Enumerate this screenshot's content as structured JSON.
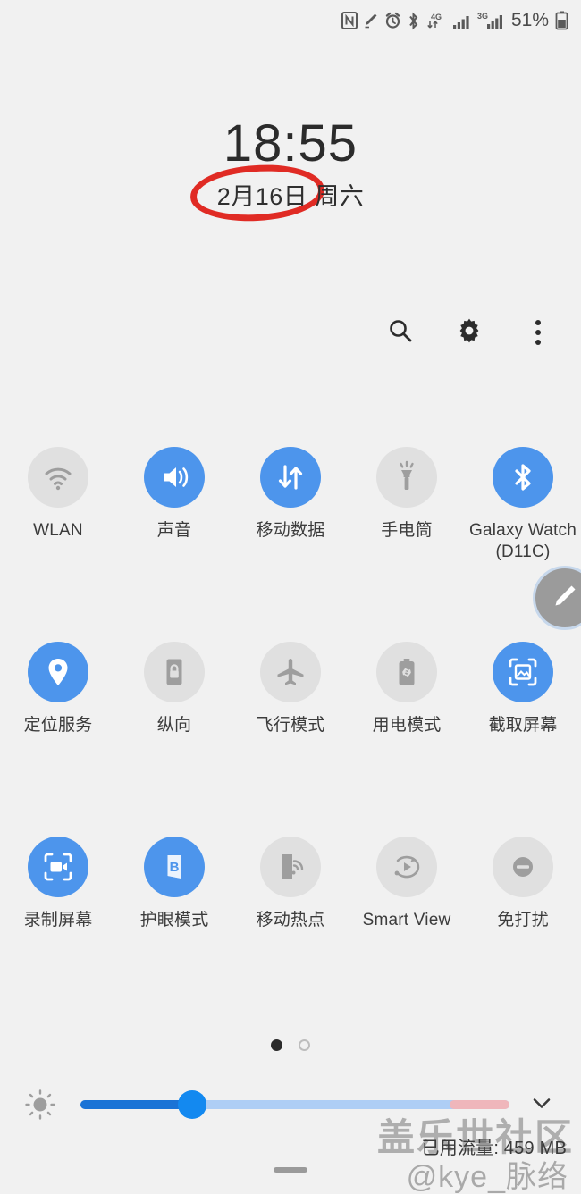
{
  "status_bar": {
    "battery_percent": "51%",
    "icons": [
      {
        "name": "nfc-icon"
      },
      {
        "name": "spen-icon"
      },
      {
        "name": "alarm-icon"
      },
      {
        "name": "bluetooth-icon"
      },
      {
        "name": "mobile-data-4g-icon",
        "label": "4G"
      },
      {
        "name": "signal-bars-sim1-icon"
      },
      {
        "name": "signal-bars-3g-sim2-icon",
        "label": "3G"
      },
      {
        "name": "battery-icon"
      }
    ]
  },
  "clock": {
    "time": "18:55",
    "date": "2月16日  周六",
    "annotation": {
      "name": "red-circle-annotation",
      "color": "#e02b24"
    }
  },
  "toolbar": {
    "search_label": "search-icon",
    "settings_label": "gear-icon",
    "more_label": "more-options-icon"
  },
  "quick_settings": {
    "rows": [
      [
        {
          "label": "WLAN",
          "icon": "wifi-icon",
          "state": "off"
        },
        {
          "label": "声音",
          "icon": "sound-icon",
          "state": "on"
        },
        {
          "label": "移动数据",
          "icon": "mobile-data-icon",
          "state": "on"
        },
        {
          "label": "手电筒",
          "icon": "flashlight-icon",
          "state": "off"
        },
        {
          "label": "Galaxy Watch\n(D11C)",
          "icon": "bluetooth-icon",
          "state": "on"
        }
      ],
      [
        {
          "label": "定位服务",
          "icon": "location-pin-icon",
          "state": "on"
        },
        {
          "label": "纵向",
          "icon": "rotation-lock-icon",
          "state": "off"
        },
        {
          "label": "飞行模式",
          "icon": "airplane-icon",
          "state": "off"
        },
        {
          "label": "用电模式",
          "icon": "power-mode-icon",
          "state": "off"
        },
        {
          "label": "截取屏幕",
          "icon": "screenshot-icon",
          "state": "on"
        }
      ],
      [
        {
          "label": "录制屏幕",
          "icon": "screen-record-icon",
          "state": "on"
        },
        {
          "label": "护眼模式",
          "icon": "blue-light-filter-icon",
          "state": "on"
        },
        {
          "label": "移动热点",
          "icon": "hotspot-icon",
          "state": "off"
        },
        {
          "label": "Smart View",
          "icon": "smart-view-icon",
          "state": "off"
        },
        {
          "label": "免打扰",
          "icon": "do-not-disturb-icon",
          "state": "off"
        }
      ]
    ],
    "colors": {
      "on": "#4d95ec",
      "off": "#e0e0e0"
    }
  },
  "edit_button": {
    "name": "edit-pencil-fab"
  },
  "pager": {
    "pages": 2,
    "active": 1
  },
  "brightness": {
    "icon": "brightness-icon",
    "value_percent": 26,
    "recording_segment_percent": 14,
    "expand_icon": "chevron-down-icon",
    "colors": {
      "fill": "#1a73d6",
      "track": "#aecef5",
      "thumb": "#1389f0",
      "recording": "#efb6bb"
    }
  },
  "data_usage": {
    "text": "已用流量: 459 MB"
  },
  "watermarks": {
    "community": "盖乐世社区",
    "user": "@kye_脉络"
  },
  "nav_hint": {
    "name": "minimize-handle"
  }
}
